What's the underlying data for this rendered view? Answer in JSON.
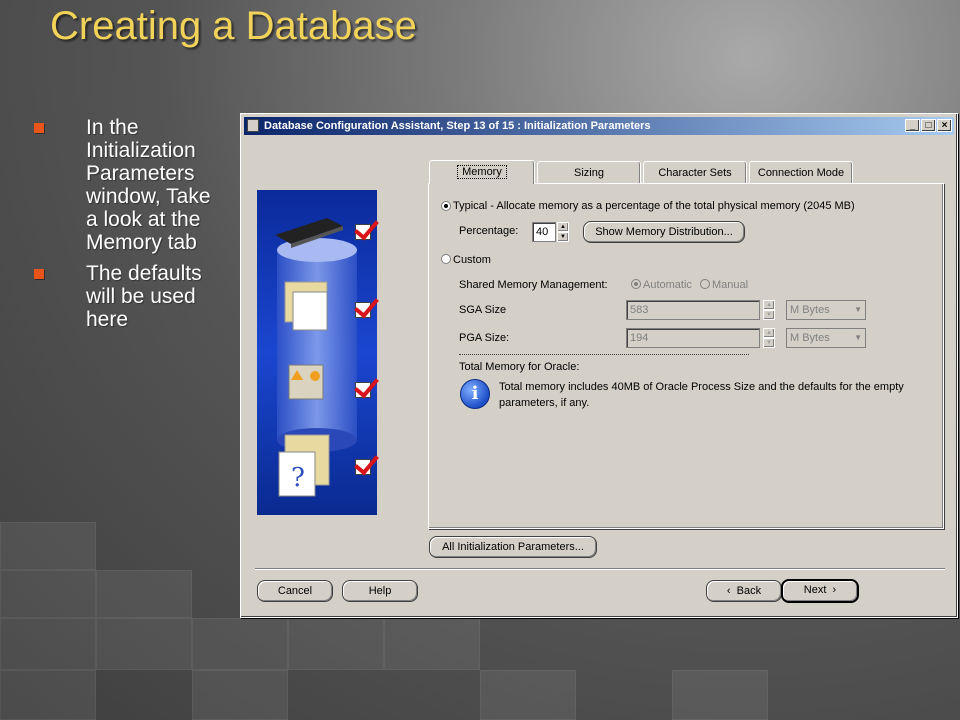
{
  "slide": {
    "title": "Creating a Database",
    "bullets": [
      "In the Initialization Parameters window, Take a look at the Memory tab",
      "The defaults will be used here"
    ]
  },
  "window": {
    "title": "Database Configuration Assistant, Step 13 of 15 : Initialization Parameters",
    "controls": {
      "minimize": "_",
      "maximize": "□",
      "close": "×"
    }
  },
  "tabs": [
    {
      "label": "Memory",
      "active": true
    },
    {
      "label": "Sizing",
      "active": false
    },
    {
      "label": "Character Sets",
      "active": false
    },
    {
      "label": "Connection Mode",
      "active": false
    }
  ],
  "memory": {
    "typical_label": "Typical - Allocate memory as a percentage of the total physical memory (2045 MB)",
    "percentage_label": "Percentage:",
    "percentage_value": "40",
    "show_distribution_label": "Show Memory Distribution...",
    "custom_label": "Custom",
    "shared_mgmt_label": "Shared Memory Management:",
    "automatic_label": "Automatic",
    "manual_label": "Manual",
    "sga_label": "SGA Size",
    "sga_value": "583",
    "sga_unit": "M Bytes",
    "pga_label": "PGA Size:",
    "pga_value": "194",
    "pga_unit": "M Bytes",
    "total_label": "Total Memory for Oracle:",
    "info_text_1": "Total memory includes 40MB of Oracle Process Size and the defaults for the empty",
    "info_text_2": "parameters, if any."
  },
  "buttons": {
    "all_params": "All Initialization Parameters...",
    "cancel": "Cancel",
    "help": "Help",
    "back": "Back",
    "next": "Next"
  },
  "colors": {
    "title": "#f2d35a",
    "bullet": "#e8541a",
    "titlebar": "#0a246a",
    "check": "#d8141a"
  }
}
